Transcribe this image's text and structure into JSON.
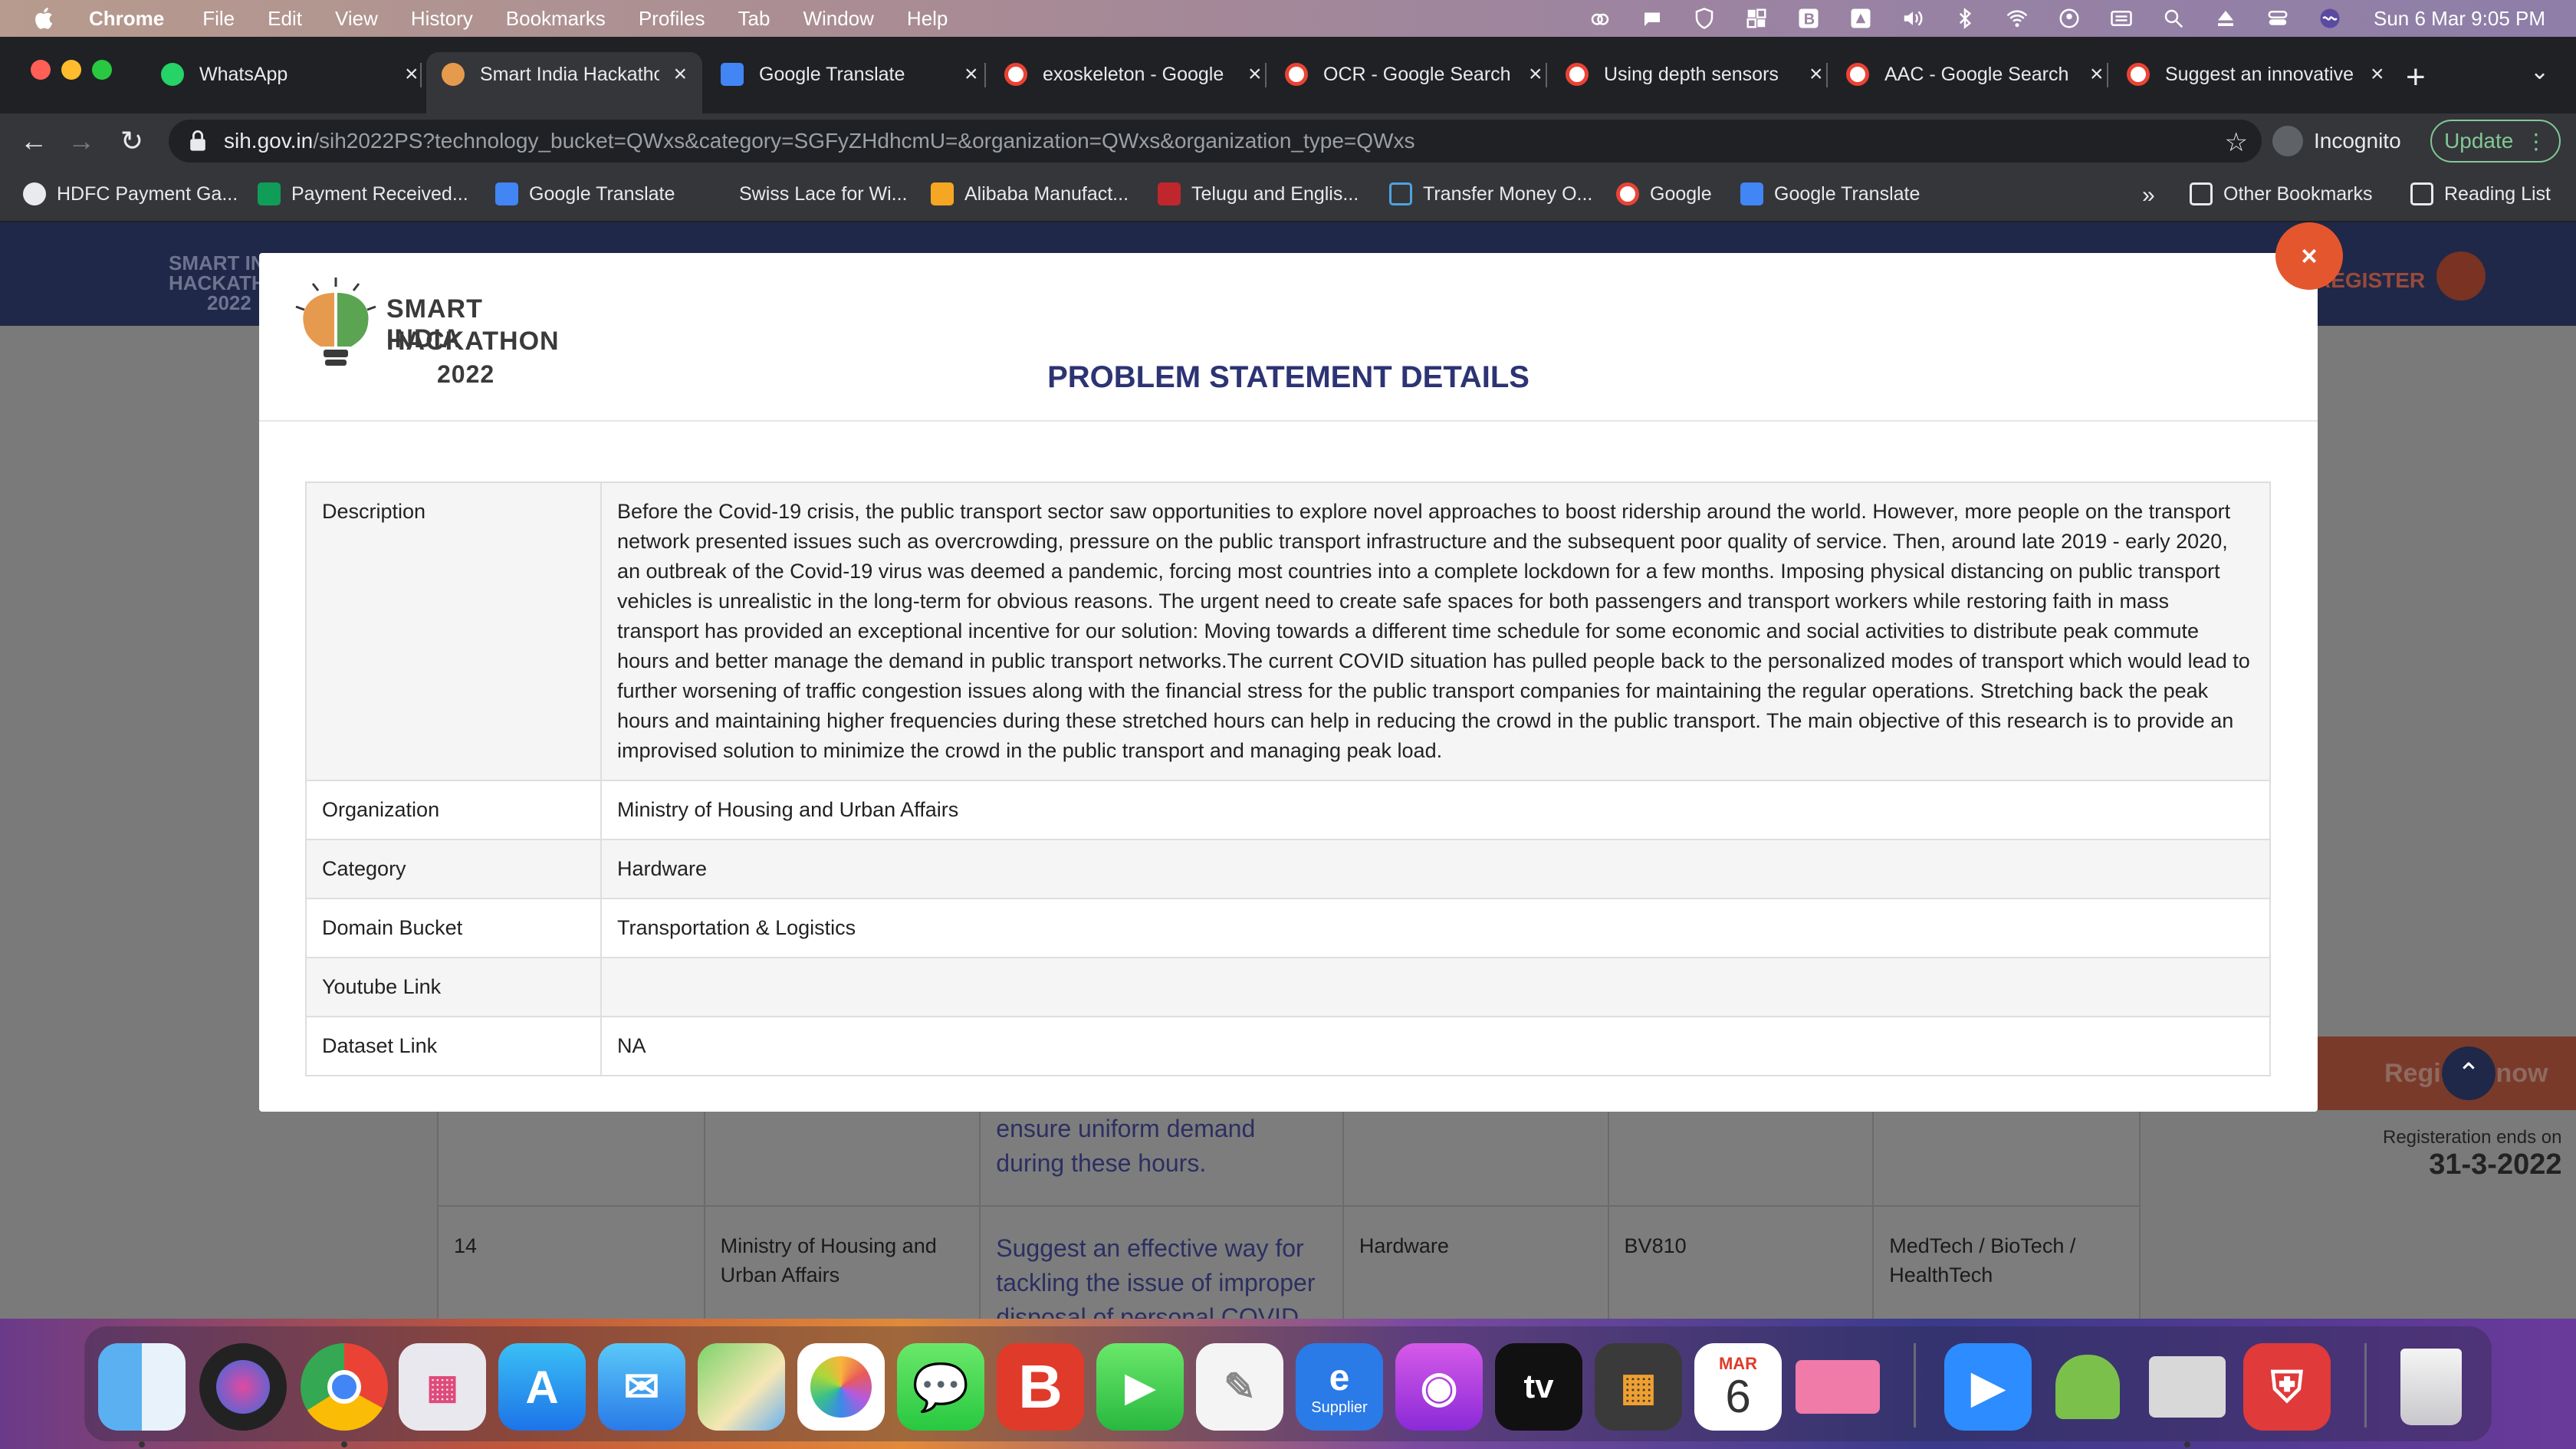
{
  "menubar": {
    "app_name": "Chrome",
    "items": [
      "File",
      "Edit",
      "View",
      "History",
      "Bookmarks",
      "Profiles",
      "Tab",
      "Window",
      "Help"
    ],
    "status_icons": [
      "creative-cloud-icon",
      "notification-icon",
      "vpn-shield-icon",
      "grid-icon",
      "b-app-icon",
      "drive-icon",
      "volume-icon",
      "bluetooth-icon",
      "wifi-icon",
      "user-circle-icon",
      "keyboard-icon",
      "spotlight-search-icon",
      "eject-icon",
      "control-center-icon",
      "siri-icon"
    ],
    "clock": "Sun 6 Mar  9:05 PM"
  },
  "tabs": [
    {
      "title": "WhatsApp",
      "favicon": "whatsapp-icon",
      "color": "#25d366",
      "active": false
    },
    {
      "title": "Smart India Hackathon",
      "favicon": "sih-icon",
      "color": "#e69a4e",
      "active": true
    },
    {
      "title": "Google Translate",
      "favicon": "translate-icon",
      "color": "#4285f4",
      "active": false
    },
    {
      "title": "exoskeleton - Google",
      "favicon": "google-icon",
      "color": "#ea4335",
      "active": false
    },
    {
      "title": "OCR - Google Search",
      "favicon": "google-icon",
      "color": "#ea4335",
      "active": false
    },
    {
      "title": "Using depth sensors",
      "favicon": "google-icon",
      "color": "#ea4335",
      "active": false
    },
    {
      "title": "AAC - Google Search",
      "favicon": "google-icon",
      "color": "#ea4335",
      "active": false
    },
    {
      "title": "Suggest an innovative",
      "favicon": "google-icon",
      "color": "#ea4335",
      "active": false
    }
  ],
  "toolbar": {
    "url_host": "sih.gov.in",
    "url_path": "/sih2022PS?technology_bucket=QWxs&category=SGFyZHdhcmU=&organization=QWxs&organization_type=QWxs",
    "profile_label": "Incognito",
    "update_label": "Update"
  },
  "bookmarks": [
    {
      "label": "HDFC Payment Ga...",
      "icon": "globe-icon"
    },
    {
      "label": "Payment Received...",
      "icon": "sheets-icon"
    },
    {
      "label": "Google Translate",
      "icon": "translate-icon"
    },
    {
      "label": "Swiss Lace for Wi...",
      "icon": "apple-icon"
    },
    {
      "label": "Alibaba Manufact...",
      "icon": "alibaba-icon"
    },
    {
      "label": "Telugu and Englis...",
      "icon": "wp-icon"
    },
    {
      "label": "Transfer Money O...",
      "icon": "transfer-icon"
    },
    {
      "label": "Google",
      "icon": "google-icon"
    },
    {
      "label": "Google Translate",
      "icon": "translate-icon"
    }
  ],
  "bookmarks_overflow": "»",
  "other_bookmarks": "Other Bookmarks",
  "reading_list": "Reading List",
  "site": {
    "logo_lines": [
      "SMART INDIA",
      "HACKATH",
      "2022"
    ],
    "register_label": "REGISTER",
    "register_now": "Register now",
    "registration_ends_label": "Registeration ends on",
    "registration_ends_date": "31-3-2022"
  },
  "background_table": {
    "prev_row_tail": "ensure uniform demand during these hours.",
    "row": {
      "sno": "14",
      "organization": "Ministry of Housing and Urban Affairs",
      "title": "Suggest an effective way for tackling the issue of improper disposal of personal COVID protection",
      "category": "Hardware",
      "code": "BV810",
      "domain": "MedTech / BioTech / HealthTech"
    }
  },
  "modal": {
    "logo": {
      "line1": "SMART INDIA",
      "line2": "HACKATHON",
      "line3": "2022"
    },
    "title": "PROBLEM STATEMENT DETAILS",
    "close_label": "×",
    "rows": [
      {
        "key": "Description",
        "value": "Before the Covid-19 crisis, the public transport sector saw opportunities to explore novel approaches to boost ridership around the world. However, more people on the transport network presented issues such as overcrowding, pressure on the public transport infrastructure and the subsequent poor quality of service. Then, around late 2019 - early 2020, an outbreak of the Covid-19 virus was deemed a pandemic, forcing most countries into a complete lockdown for a few months. Imposing physical distancing on public transport vehicles is unrealistic in the long-term for obvious reasons. The urgent need to create safe spaces for both passengers and transport workers while restoring faith in mass transport has provided an exceptional incentive for our solution: Moving towards a different time schedule for some economic and social activities to distribute peak commute hours and better manage the demand in public transport networks.The current COVID situation has pulled people back to the personalized modes of transport which would lead to further worsening of traffic congestion issues along with the financial stress for the public transport companies for maintaining the regular operations. Stretching back the peak hours and maintaining higher frequencies during these stretched hours can help in reducing the crowd in the public transport. The main objective of this research is to provide an improvised solution to minimize the crowd in the public transport and managing peak load."
      },
      {
        "key": "Organization",
        "value": "Ministry of Housing and Urban Affairs"
      },
      {
        "key": "Category",
        "value": "Hardware"
      },
      {
        "key": "Domain Bucket",
        "value": "Transportation & Logistics"
      },
      {
        "key": "Youtube Link",
        "value": ""
      },
      {
        "key": "Dataset Link",
        "value": "NA"
      }
    ]
  },
  "dock": {
    "calendar_month": "MAR",
    "calendar_day": "6",
    "supplier_label": "Supplier",
    "tv_label": "tv"
  },
  "colors": {
    "modal_title": "#2c3473",
    "close_button": "#e4572e",
    "site_header": "#1f2848"
  }
}
